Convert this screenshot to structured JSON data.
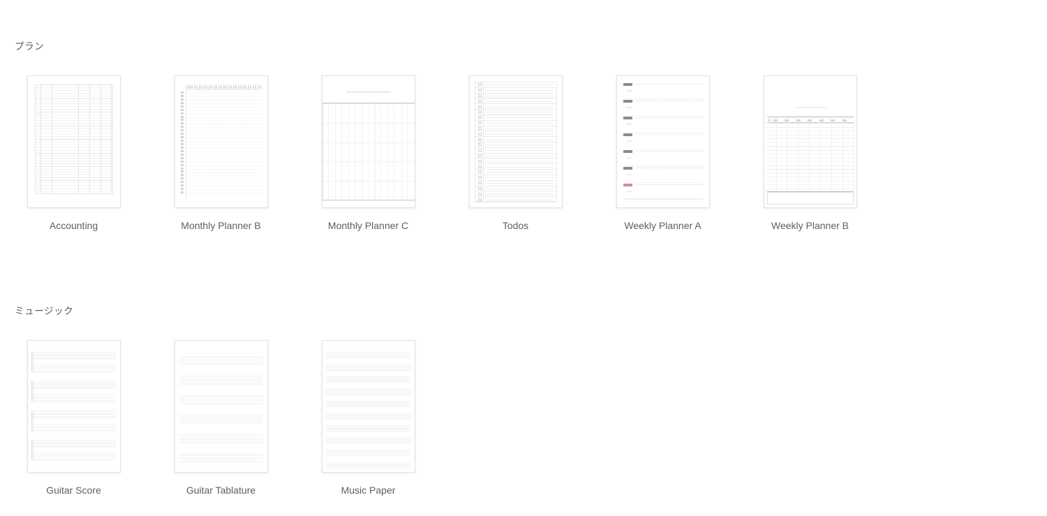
{
  "sections": [
    {
      "id": "plan",
      "title": "プラン",
      "items": [
        {
          "label": "Accounting",
          "preview": "accounting"
        },
        {
          "label": "Monthly Planner B",
          "preview": "monthly-b"
        },
        {
          "label": "Monthly Planner C",
          "preview": "monthly-c"
        },
        {
          "label": "Todos",
          "preview": "todos"
        },
        {
          "label": "Weekly Planner A",
          "preview": "weekly-a"
        },
        {
          "label": "Weekly Planner B",
          "preview": "weekly-b"
        }
      ]
    },
    {
      "id": "music",
      "title": "ミュージック",
      "items": [
        {
          "label": "Guitar Score",
          "preview": "guitar-score"
        },
        {
          "label": "Guitar Tablature",
          "preview": "guitar-tab"
        },
        {
          "label": "Music Paper",
          "preview": "music-paper"
        }
      ]
    }
  ],
  "colors": {
    "background": "#ffffff",
    "caption_text": "#5e5e5e",
    "section_title_text": "#5b5b5b",
    "thumbnail_border": "#e3e3e3",
    "rule_light": "#ececec",
    "rule_dark": "#b9b9b9",
    "sunday_accent": "#d98a96"
  }
}
